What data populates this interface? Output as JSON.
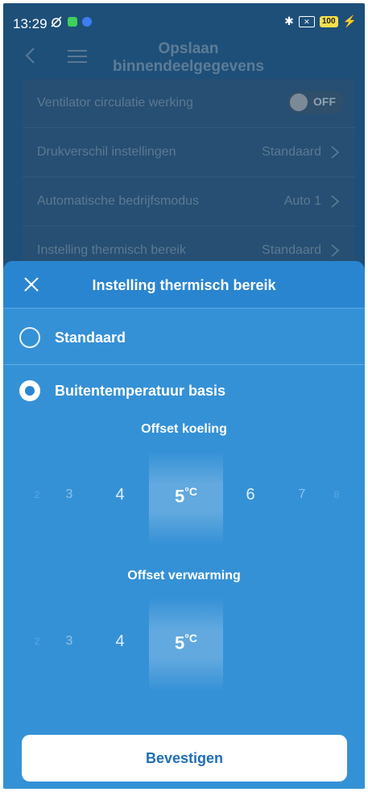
{
  "status_bar": {
    "time": "13:29",
    "battery": "100"
  },
  "header": {
    "title": "Opslaan binnendeelgegevens"
  },
  "settings": [
    {
      "label": "Ventilator circulatie werking",
      "toggle": "OFF"
    },
    {
      "label": "Drukverschil instellingen",
      "value": "Standaard"
    },
    {
      "label": "Automatische bedrijfsmodus",
      "value": "Auto 1"
    },
    {
      "label": "Instelling thermisch bereik",
      "value": "Standaard"
    }
  ],
  "sheet": {
    "title": "Instelling thermisch bereik",
    "options": [
      {
        "label": "Standaard",
        "selected": false
      },
      {
        "label": "Buitentemperatuur basis",
        "selected": true
      }
    ],
    "cooling": {
      "label": "Offset koeling",
      "values": [
        "2",
        "3",
        "4",
        "5",
        "6",
        "7",
        "8"
      ],
      "selected": "5",
      "unit": "°C"
    },
    "heating": {
      "label": "Offset verwarming",
      "values": [
        "2",
        "3",
        "4",
        "5"
      ],
      "selected": "5",
      "unit": "°C"
    },
    "confirm_label": "Bevestigen"
  }
}
